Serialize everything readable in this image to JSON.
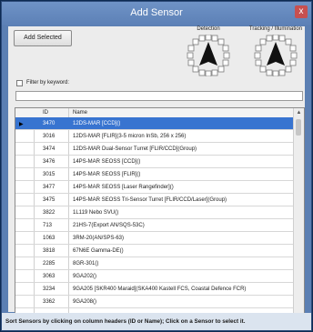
{
  "window": {
    "title": "Add Sensor",
    "close_glyph": "x"
  },
  "toolbar": {
    "add_selected_label": "Add Selected"
  },
  "panels": {
    "detection_label": "Detection",
    "tracking_label": "Tracking / Illumination"
  },
  "filter": {
    "label": "Filter by keyword:",
    "checked": false,
    "value": ""
  },
  "table": {
    "columns": [
      "ID",
      "Name"
    ],
    "selected_row": 0,
    "rows": [
      {
        "id": "3470",
        "name": "12DS-MAR [CCD]()"
      },
      {
        "id": "3016",
        "name": "12DS-MAR [FLIR](3-5 micron InSb, 256 x 256)"
      },
      {
        "id": "3474",
        "name": "12DS-MAR Dual-Sensor Turret [FLIR/CCD](Group)"
      },
      {
        "id": "3476",
        "name": "14PS-MAR SEOSS [CCD]()"
      },
      {
        "id": "3015",
        "name": "14PS-MAR SEOSS [FLIR]()"
      },
      {
        "id": "3477",
        "name": "14PS-MAR SEOSS [Laser Rangefinder]()"
      },
      {
        "id": "3475",
        "name": "14PS-MAR SEOSS Tri-Sensor Turret [FLIR/CCD/Laser](Group)"
      },
      {
        "id": "3822",
        "name": "1L119 Nebo SVU()"
      },
      {
        "id": "713",
        "name": "21HS-7(Export AN/SQS-53C)"
      },
      {
        "id": "1063",
        "name": "3RM-20(AN/SPS-63)"
      },
      {
        "id": "3818",
        "name": "67N6E Gamma-DE()"
      },
      {
        "id": "2285",
        "name": "8GR-301()"
      },
      {
        "id": "3063",
        "name": "9GA202()"
      },
      {
        "id": "3234",
        "name": "9GA205 [SKR400 Maraid](SKA400 Kastell FCS, Coastal Defence FCR)"
      },
      {
        "id": "3362",
        "name": "9GA208()"
      }
    ]
  },
  "status": {
    "text": "Sort Sensors by clicking on column headers (ID or Name); Click on a Sensor to select it."
  }
}
